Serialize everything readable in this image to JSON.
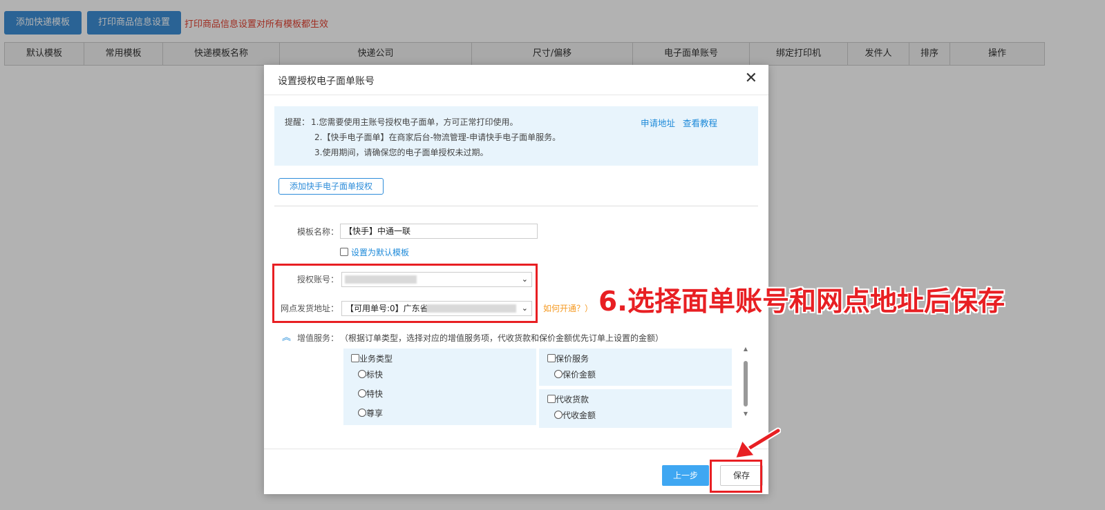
{
  "toolbar": {
    "add_template_label": "添加快递模板",
    "print_settings_label": "打印商品信息设置",
    "notice": "打印商品信息设置对所有模板都生效"
  },
  "table": {
    "columns": [
      "默认模板",
      "常用模板",
      "快递模板名称",
      "快递公司",
      "尺寸/偏移",
      "电子面单账号",
      "绑定打印机",
      "发件人",
      "排序",
      "操作"
    ]
  },
  "modal": {
    "title": "设置授权电子面单账号",
    "close_symbol": "✕",
    "tip": {
      "label": "提醒：",
      "line1": "1.您需要使用主账号授权电子面单，方可正常打印使用。",
      "line2": "2.【快手电子面单】在商家后台-物流管理-申请快手电子面单服务。",
      "line3": "3.使用期间，请确保您的电子面单授权未过期。",
      "apply_link": "申请地址",
      "tutorial_link": "查看教程"
    },
    "add_auth_button": "添加快手电子面单授权",
    "template_name_label": "模板名称：",
    "template_name_value": "【快手】中通一联",
    "set_default_label": "设置为默认模板",
    "auth_account_label": "授权账号：",
    "branch_address_label": "网点发货地址：",
    "branch_address_value": "【可用单号:0】广东省",
    "how_to_open_link": "如何开通？）",
    "vas": {
      "label": "增值服务：",
      "desc": "（根据订单类型，选择对应的增值服务项，代收货款和保价金额优先订单上设置的金额）",
      "business_type": "业务类型",
      "options": [
        "标快",
        "特快",
        "尊享"
      ],
      "insured": "保价服务",
      "insured_amount": "保价金额",
      "cod": "代收货款",
      "cod_amount": "代收金额"
    },
    "prev_button": "上一步",
    "save_button": "保存"
  },
  "annotation": "6.选择面单账号和网点地址后保存",
  "colors": {
    "primary_blue": "#3d8fd6",
    "annotation_red": "#e81f23",
    "link_blue": "#1e8ad9",
    "orange": "#f59a23",
    "tip_bg": "#e8f4fc"
  }
}
